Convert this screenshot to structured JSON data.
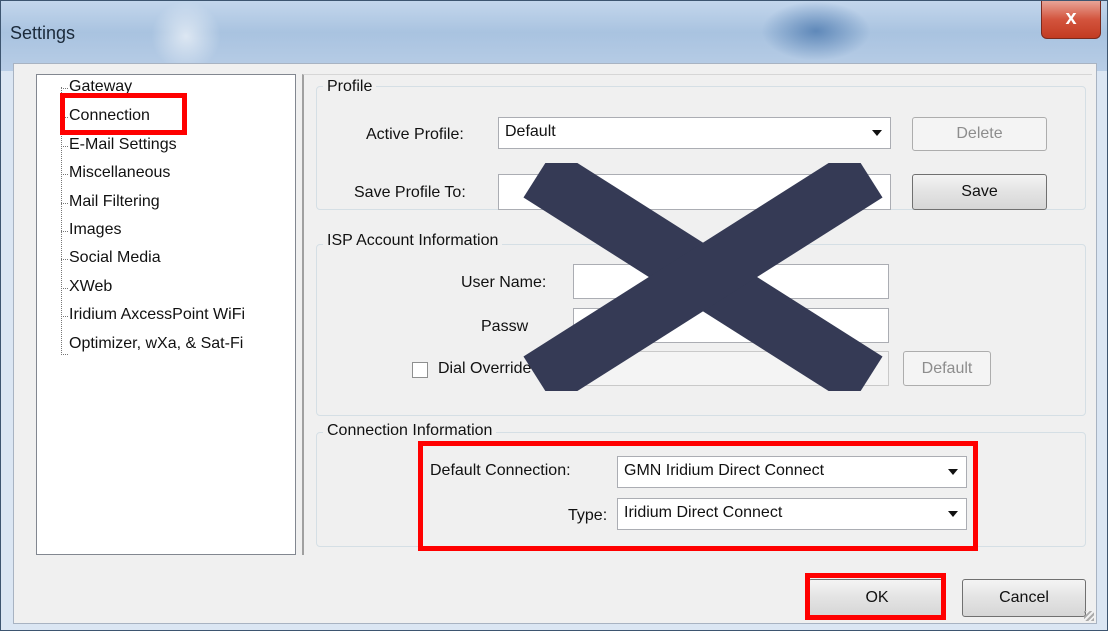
{
  "window": {
    "title": "Settings",
    "close_label": "x"
  },
  "tree": {
    "items": [
      "Gateway",
      "Connection",
      "E-Mail Settings",
      "Miscellaneous",
      "Mail Filtering",
      "Images",
      "Social Media",
      "XWeb",
      "Iridium AxcessPoint WiFi",
      "Optimizer, wXa, & Sat-Fi"
    ],
    "selected": "Connection"
  },
  "profile": {
    "group_label": "Profile",
    "active_profile_label": "Active Profile:",
    "active_profile_value": "Default",
    "delete_label": "Delete",
    "save_profile_to_label": "Save Profile To:",
    "save_label": "Save"
  },
  "isp": {
    "group_label": "ISP Account Information",
    "user_name_label": "User Name:",
    "password_label": "Passw",
    "dial_override_label": "Dial Override",
    "default_label": "Default"
  },
  "connection": {
    "group_label": "Connection Information",
    "default_connection_label": "Default Connection:",
    "default_connection_value": "GMN Iridium Direct Connect",
    "type_label": "Type:",
    "type_value": "Iridium Direct Connect"
  },
  "footer": {
    "ok_label": "OK",
    "cancel_label": "Cancel"
  },
  "annotations": {
    "highlight_color": "#ff0000",
    "cross_color": "#353a55"
  }
}
